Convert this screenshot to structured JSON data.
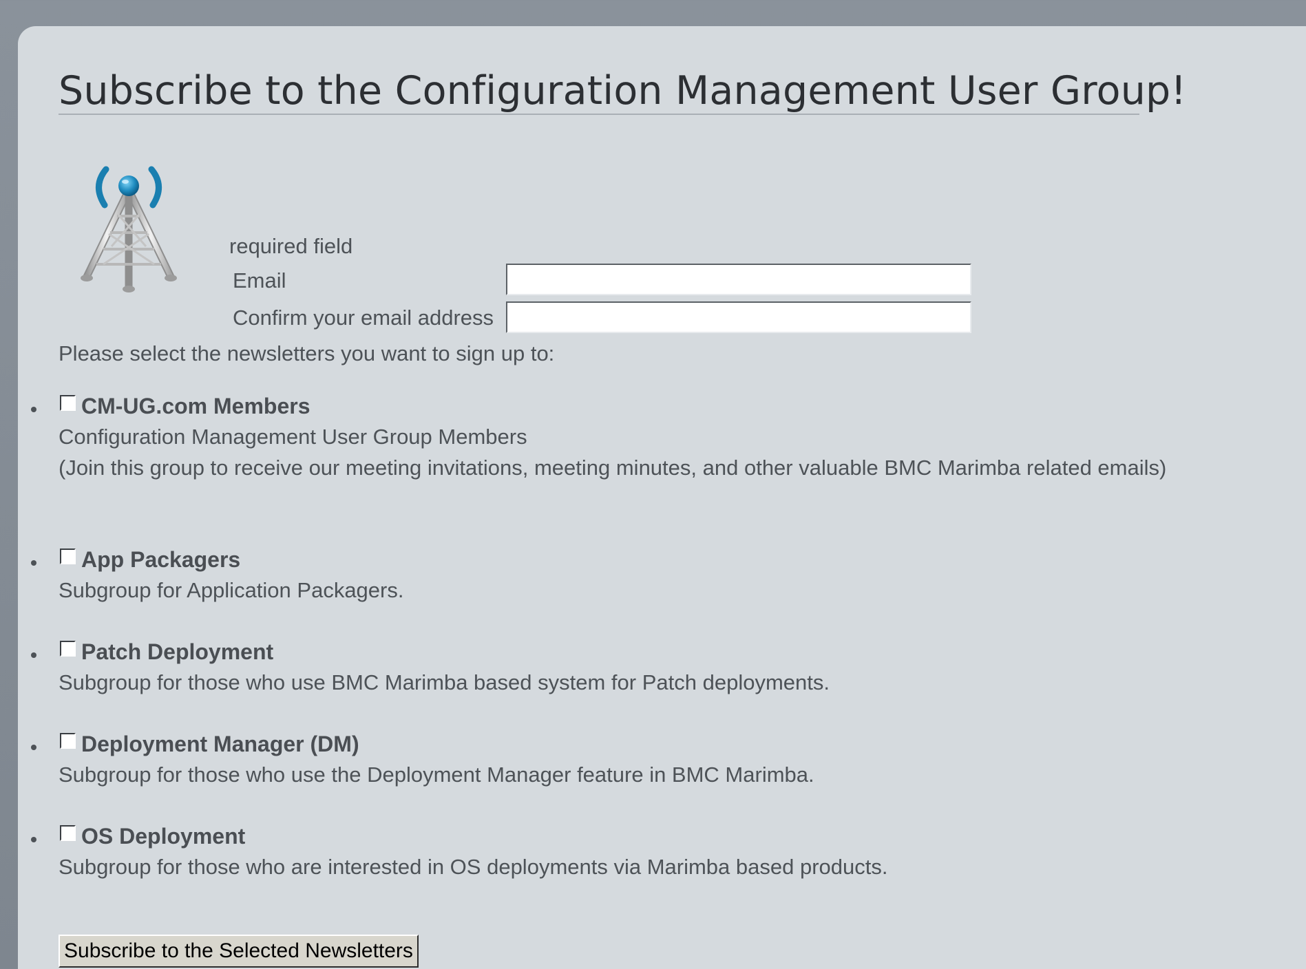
{
  "page": {
    "title": "Subscribe to the Configuration Management User Group!"
  },
  "form": {
    "required_note": "required field",
    "email_label": "Email",
    "email_value": "",
    "confirm_label": "Confirm your email address",
    "confirm_value": "",
    "select_prompt": "Please select the newsletters you want to sign up to:",
    "submit_label": "Subscribe to the Selected Newsletters"
  },
  "newsletters": [
    {
      "title": "CM-UG.com Members",
      "description": "Configuration Management User Group Members",
      "note": "(Join this group to receive our meeting invitations, meeting minutes, and other valuable BMC Marimba related emails)",
      "checked": false
    },
    {
      "title": "App Packagers",
      "description": "Subgroup for Application Packagers.",
      "checked": false
    },
    {
      "title": "Patch Deployment",
      "description": "Subgroup for those who use BMC Marimba based system for Patch deployments.",
      "checked": false
    },
    {
      "title": "Deployment Manager (DM)",
      "description": "Subgroup for those who use the Deployment Manager feature in BMC Marimba.",
      "checked": false
    },
    {
      "title": "OS Deployment",
      "description": "Subgroup for those who are interested in OS deployments via Marimba based products.",
      "checked": false
    }
  ],
  "icons": {
    "logo": "broadcast-tower-icon"
  },
  "colors": {
    "background": "#8a929b",
    "panel": "#d5dade",
    "title_text": "#2c2f33",
    "body_text": "#4d5257",
    "tower_signal": "#1a7fb0"
  }
}
